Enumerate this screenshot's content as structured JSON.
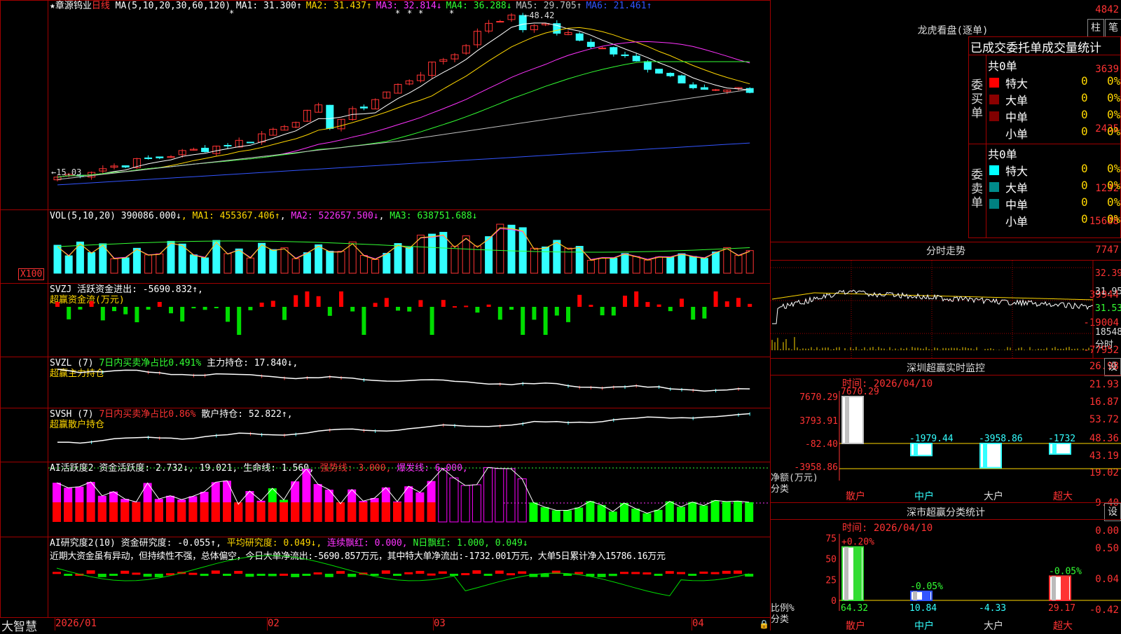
{
  "main": {
    "title_prefix": "★章源钨业",
    "period": "日线",
    "ma_label": "MA(5,10,20,30,60,120)",
    "ma_values": [
      {
        "text": "MA1: 31.300↑",
        "color": "#ffffff"
      },
      {
        "text": "MA2: 31.437↑",
        "color": "#ffd700"
      },
      {
        "text": "MA3: 32.814↓",
        "color": "#ff33ff"
      },
      {
        "text": "MA4: 36.288↓",
        "color": "#33ff33"
      },
      {
        "text": "MA5: 29.705↑",
        "color": "#c0c0c0"
      },
      {
        "text": "MA6: 21.461↑",
        "color": "#3355ff"
      }
    ],
    "y_ticks": [
      "4842",
      "3639",
      "2435",
      "1232"
    ],
    "high_label": "48.42",
    "low_label": "15.03"
  },
  "vol": {
    "label": "VOL(5,10,20)",
    "value": "390086.000↓",
    "ma1": "MA1: 455367.406↑",
    "ma2": "MA2: 522657.500↓",
    "ma3": "MA3: 638751.688↓",
    "y_ticks": [
      "15688",
      "7747"
    ],
    "unit": "X100"
  },
  "svzj": {
    "label": "SVZJ",
    "text": "活跃资金进出: -5690.832↑,",
    "sub": "超赢资金流(万元)",
    "y_ticks": [
      "39944",
      "-19004",
      "-77952"
    ]
  },
  "svzl": {
    "label": "SVZL (7)",
    "text1": "7日内买卖净占比0.491%",
    "text2": "主力持仓: 17.840↓,",
    "sub": "超赢主力持仓",
    "y_ticks": [
      "26.98",
      "21.93",
      "16.87"
    ]
  },
  "svsh": {
    "label": "SVSH (7)",
    "text1": "7日内买卖净占比0.86%",
    "text2": "散户持仓: 52.822↑,",
    "sub": "超赢散户持仓",
    "y_ticks": [
      "53.72",
      "48.36",
      "43.19"
    ]
  },
  "ai1": {
    "label": "AI活跃度2",
    "t1": "资金活跃度: 2.732↓,",
    "t2": "19.021,",
    "t3": "生命线: 1.560,",
    "t4": "强势线: 3.000,",
    "t5": "爆发线: 6.000,",
    "y_ticks": [
      "19.02",
      "9.40",
      "0.00"
    ]
  },
  "ai2": {
    "label": "AI研究度2(10)",
    "t1": "资金研究度: -0.055↑,",
    "t2": "平均研究度: 0.049↓,",
    "t3": "连续飘红: 0.000,",
    "t4": "N日飘红: 1.000,",
    "t5": "0.049↓",
    "comment": "近期大资金虽有异动，但持续性不强，总体偏空，今日大单净流出:-5690.857万元，其中特大单净流出:-1732.001万元，大单5日累计净入15786.16万元",
    "y_ticks": [
      "0.50",
      "0.04",
      "-0.42"
    ]
  },
  "xaxis": {
    "brand": "大智慧",
    "labels": [
      "2026/01",
      "02",
      "03",
      "04"
    ]
  },
  "right": {
    "lhb_title": "龙虎看盘(逐单)",
    "btn_bar": "柱",
    "btn_pen": "笔",
    "table_title": "已成交委托单成交量统计",
    "buy_side": "委买单",
    "sell_side": "委卖单",
    "buy_total": "共0单",
    "sell_total": "共0单",
    "buy_rows": [
      {
        "name": "特大",
        "count": "0",
        "pct": "0%",
        "color": "#ff0000"
      },
      {
        "name": "大单",
        "count": "0",
        "pct": "0%",
        "color": "#8b0000"
      },
      {
        "name": "中单",
        "count": "0",
        "pct": "0%",
        "color": "#800000"
      },
      {
        "name": "小单",
        "count": "0",
        "pct": "0%",
        "color": ""
      }
    ],
    "sell_rows": [
      {
        "name": "特大",
        "count": "0",
        "pct": "0%",
        "color": "#00ffff"
      },
      {
        "name": "大单",
        "count": "0",
        "pct": "0%",
        "color": "#008b8b"
      },
      {
        "name": "中单",
        "count": "0",
        "pct": "0%",
        "color": "#008080"
      },
      {
        "name": "小单",
        "count": "0",
        "pct": "0%",
        "color": ""
      }
    ],
    "intraday_title": "分时走势",
    "intraday_ticks": [
      "32.39",
      "31.95",
      "31.53",
      "18548",
      "分时"
    ],
    "sz_monitor_title": "深圳超赢实时监控",
    "sz_btn": "设",
    "time1": "时间: 2026/04/10",
    "net_label": "净额(万元)",
    "cat_label": "分类",
    "sz_ticks": [
      "7670.29",
      "3793.91",
      "-82.40",
      "-3958.86"
    ],
    "cls_title": "深市超赢分类统计",
    "cls_btn": "设",
    "time2": "时间: 2026/04/10",
    "ratio_label": "比例%",
    "ratio_ticks": [
      "75",
      "50",
      "25",
      "0"
    ]
  },
  "chart_data": [
    {
      "type": "bar",
      "title": "深圳超赢实时监控",
      "ylabel": "净额(万元)",
      "categories": [
        "散户",
        "中户",
        "大户",
        "超大"
      ],
      "values": [
        7670.29,
        -1979.44,
        -3958.86,
        -1732
      ],
      "ylim": [
        -3958.86,
        7670.29
      ]
    },
    {
      "type": "bar",
      "title": "深市超赢分类统计",
      "ylabel": "比例%",
      "categories": [
        "散户",
        "中户",
        "大户",
        "超大"
      ],
      "series": [
        {
          "name": "占比",
          "values": [
            64.32,
            10.84,
            -4.33,
            29.17
          ]
        },
        {
          "name": "变化",
          "values": [
            0.2,
            -0.05,
            0,
            -0.05
          ]
        }
      ],
      "top_labels": [
        "+0.20%",
        "-0.05%",
        "",
        "-0.05%"
      ],
      "ylim": [
        0,
        75
      ]
    },
    {
      "type": "line",
      "title": "章源钨业 日线",
      "x": [
        "2026/01",
        "02",
        "03",
        "04"
      ],
      "series": [
        {
          "name": "MA1",
          "values": [
            31.3
          ]
        },
        {
          "name": "MA2",
          "values": [
            31.437
          ]
        },
        {
          "name": "MA3",
          "values": [
            32.814
          ]
        },
        {
          "name": "MA4",
          "values": [
            36.288
          ]
        },
        {
          "name": "MA5",
          "values": [
            29.705
          ]
        },
        {
          "name": "MA6",
          "values": [
            21.461
          ]
        }
      ],
      "ylim": [
        12.32,
        48.42
      ]
    }
  ]
}
